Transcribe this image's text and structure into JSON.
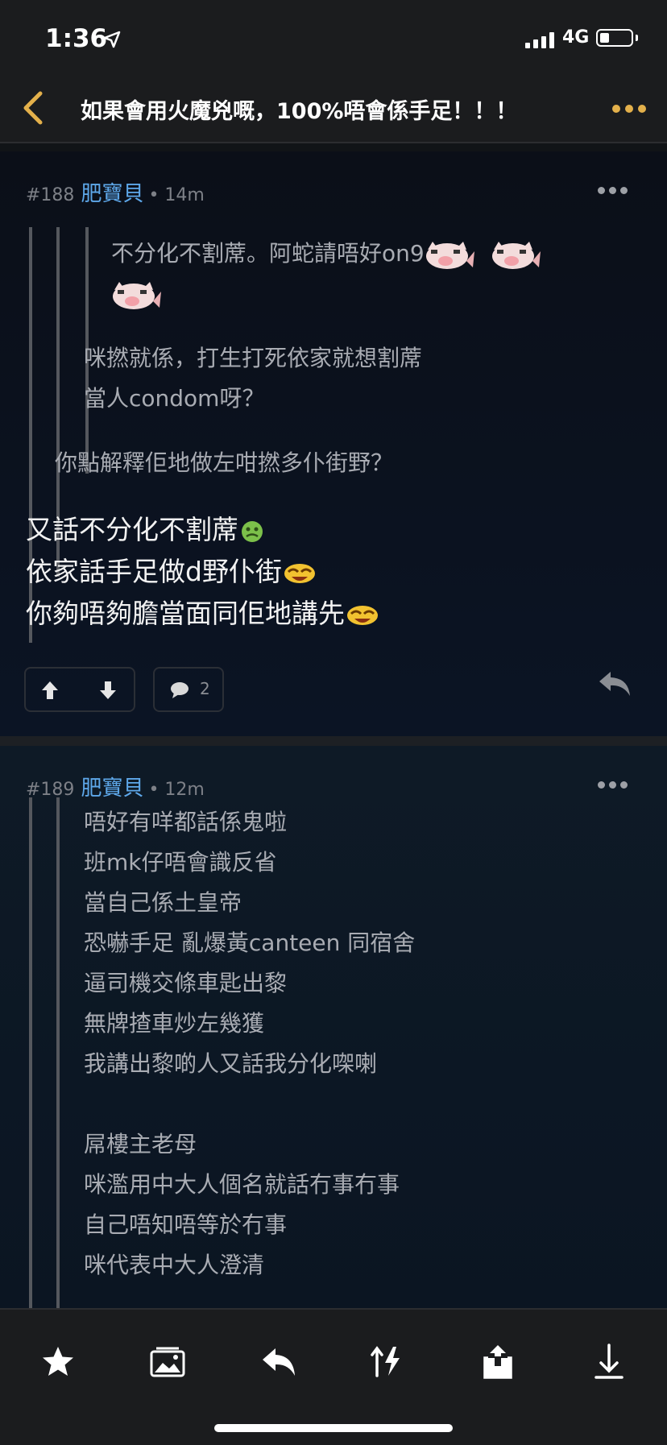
{
  "status_bar": {
    "time": "1:36",
    "network": "4G"
  },
  "nav": {
    "title": "如果會用火魔兇嘅，100%唔會係手足！！！"
  },
  "posts": [
    {
      "floor": "#188",
      "username": "肥寶貝",
      "age": "• 14m",
      "quote_inner_line1": "不分化不割蓆。阿蛇請唔好on9",
      "quote_mid_line1": "咪撚就係，打生打死依家就想割蓆",
      "quote_mid_line2": "當人condom呀？",
      "quote_outer_line1": "你點解釋佢地做左咁撚多仆街野？",
      "body_line1": "又話不分化不割蓆",
      "body_line2": "依家話手足做d野仆街",
      "body_line3": "你夠唔夠膽當面同佢地講先",
      "comment_count": "2"
    },
    {
      "floor": "#189",
      "username": "肥寶貝",
      "age": "• 12m",
      "quote_lines": [
        "唔好有咩都話係鬼啦",
        "班mk仔唔會識反省",
        "當自己係土皇帝",
        "恐嚇手足 亂爆黃canteen 同宿舍",
        "逼司機交條車匙出黎",
        "無牌揸車炒左幾獲",
        "我講出黎啲人又話我分化㗎喇",
        "屌樓主老母",
        "咪濫用中大人個名就話冇事冇事",
        "自己唔知唔等於冇事",
        "咪代表中大人澄清"
      ]
    }
  ],
  "icons": {
    "back": "chevron-left-icon",
    "more": "ellipsis-icon",
    "upvote": "arrow-up-icon",
    "downvote": "arrow-down-icon",
    "comment": "comment-icon",
    "reply": "reply-icon",
    "star": "star-icon",
    "image": "image-icon",
    "pig": "pig-sticker-icon",
    "sick": "sick-face-icon",
    "laugh": "laughing-face-icon"
  },
  "colors": {
    "accent": "#e3b04b",
    "username": "#5ea8ea",
    "background": "#0a0e16"
  }
}
